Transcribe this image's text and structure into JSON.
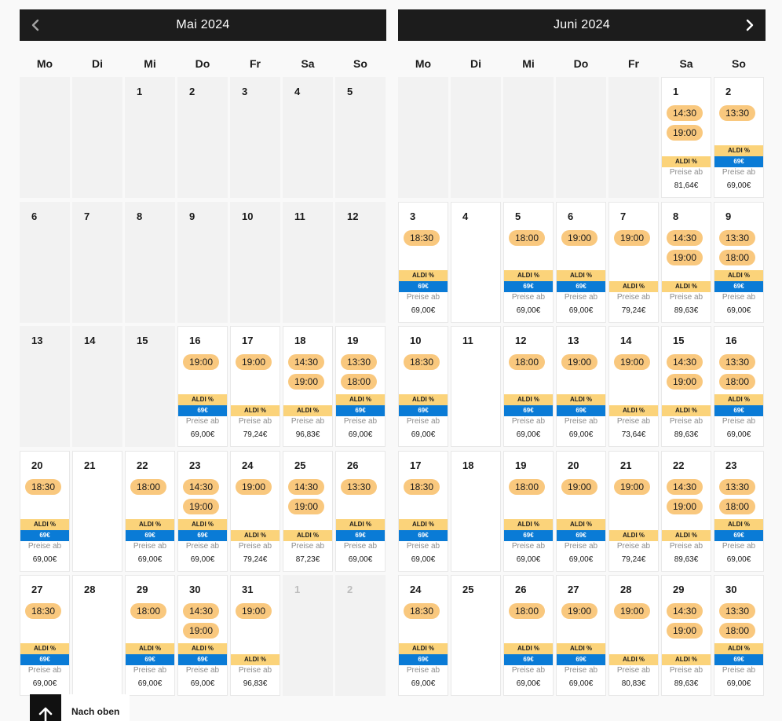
{
  "weekdays": [
    "Mo",
    "Di",
    "Mi",
    "Do",
    "Fr",
    "Sa",
    "So"
  ],
  "labels": {
    "aldi_discount": "ALDI %",
    "price_from": "Preise ab",
    "back_to_top": "Nach oben"
  },
  "icons": {
    "previous_month": "chevron-left-icon",
    "next_month": "chevron-right-icon",
    "back_to_top": "arrow-up-icon"
  },
  "colors": {
    "page_background": "#f9f9f9",
    "header_background": "#1c1c1c",
    "showtime_pill": "#f9c87e",
    "aldi_badge": "#fbd37a",
    "aldi_price_badge": "#0a7bd6",
    "unavailable_day": "#f2f2f2"
  },
  "months": [
    {
      "title": "Mai 2024",
      "days": [
        {},
        {},
        {
          "day": "1",
          "available": false
        },
        {
          "day": "2",
          "available": false
        },
        {
          "day": "3",
          "available": false
        },
        {
          "day": "4",
          "available": false
        },
        {
          "day": "5",
          "available": false
        },
        {
          "day": "6",
          "available": false
        },
        {
          "day": "7",
          "available": false
        },
        {
          "day": "8",
          "available": false
        },
        {
          "day": "9",
          "available": false
        },
        {
          "day": "10",
          "available": false
        },
        {
          "day": "11",
          "available": false
        },
        {
          "day": "12",
          "available": false
        },
        {
          "day": "13",
          "available": false
        },
        {
          "day": "14",
          "available": false
        },
        {
          "day": "15",
          "available": false
        },
        {
          "day": "16",
          "available": true,
          "times": [
            "19:00"
          ],
          "deal": "69€",
          "price": "69,00€"
        },
        {
          "day": "17",
          "available": true,
          "times": [
            "19:00"
          ],
          "price": "79,24€"
        },
        {
          "day": "18",
          "available": true,
          "times": [
            "14:30",
            "19:00"
          ],
          "price": "96,83€"
        },
        {
          "day": "19",
          "available": true,
          "times": [
            "13:30",
            "18:00"
          ],
          "deal": "69€",
          "price": "69,00€"
        },
        {
          "day": "20",
          "available": true,
          "times": [
            "18:30"
          ],
          "deal": "69€",
          "price": "69,00€"
        },
        {
          "day": "21",
          "available": true
        },
        {
          "day": "22",
          "available": true,
          "times": [
            "18:00"
          ],
          "deal": "69€",
          "price": "69,00€"
        },
        {
          "day": "23",
          "available": true,
          "times": [
            "14:30",
            "19:00"
          ],
          "deal": "69€",
          "price": "69,00€"
        },
        {
          "day": "24",
          "available": true,
          "times": [
            "19:00"
          ],
          "price": "79,24€"
        },
        {
          "day": "25",
          "available": true,
          "times": [
            "14:30",
            "19:00"
          ],
          "price": "87,23€"
        },
        {
          "day": "26",
          "available": true,
          "times": [
            "13:30"
          ],
          "deal": "69€",
          "price": "69,00€"
        },
        {
          "day": "27",
          "available": true,
          "times": [
            "18:30"
          ],
          "deal": "69€",
          "price": "69,00€"
        },
        {
          "day": "28",
          "available": true
        },
        {
          "day": "29",
          "available": true,
          "times": [
            "18:00"
          ],
          "deal": "69€",
          "price": "69,00€"
        },
        {
          "day": "30",
          "available": true,
          "times": [
            "14:30",
            "19:00"
          ],
          "deal": "69€",
          "price": "69,00€"
        },
        {
          "day": "31",
          "available": true,
          "times": [
            "19:00"
          ],
          "price": "96,83€"
        },
        {
          "day": "1",
          "available": false,
          "other_month": true
        },
        {
          "day": "2",
          "available": false,
          "other_month": true
        }
      ]
    },
    {
      "title": "Juni 2024",
      "days": [
        {},
        {},
        {},
        {},
        {},
        {
          "day": "1",
          "available": true,
          "times": [
            "14:30",
            "19:00"
          ],
          "price": "81,64€"
        },
        {
          "day": "2",
          "available": true,
          "times": [
            "13:30"
          ],
          "deal": "69€",
          "price": "69,00€"
        },
        {
          "day": "3",
          "available": true,
          "times": [
            "18:30"
          ],
          "deal": "69€",
          "price": "69,00€"
        },
        {
          "day": "4",
          "available": true
        },
        {
          "day": "5",
          "available": true,
          "times": [
            "18:00"
          ],
          "deal": "69€",
          "price": "69,00€"
        },
        {
          "day": "6",
          "available": true,
          "times": [
            "19:00"
          ],
          "deal": "69€",
          "price": "69,00€"
        },
        {
          "day": "7",
          "available": true,
          "times": [
            "19:00"
          ],
          "price": "79,24€"
        },
        {
          "day": "8",
          "available": true,
          "times": [
            "14:30",
            "19:00"
          ],
          "price": "89,63€"
        },
        {
          "day": "9",
          "available": true,
          "times": [
            "13:30",
            "18:00"
          ],
          "deal": "69€",
          "price": "69,00€"
        },
        {
          "day": "10",
          "available": true,
          "times": [
            "18:30"
          ],
          "deal": "69€",
          "price": "69,00€"
        },
        {
          "day": "11",
          "available": true
        },
        {
          "day": "12",
          "available": true,
          "times": [
            "18:00"
          ],
          "deal": "69€",
          "price": "69,00€"
        },
        {
          "day": "13",
          "available": true,
          "times": [
            "19:00"
          ],
          "deal": "69€",
          "price": "69,00€"
        },
        {
          "day": "14",
          "available": true,
          "times": [
            "19:00"
          ],
          "price": "73,64€"
        },
        {
          "day": "15",
          "available": true,
          "times": [
            "14:30",
            "19:00"
          ],
          "price": "89,63€"
        },
        {
          "day": "16",
          "available": true,
          "times": [
            "13:30",
            "18:00"
          ],
          "deal": "69€",
          "price": "69,00€"
        },
        {
          "day": "17",
          "available": true,
          "times": [
            "18:30"
          ],
          "deal": "69€",
          "price": "69,00€"
        },
        {
          "day": "18",
          "available": true
        },
        {
          "day": "19",
          "available": true,
          "times": [
            "18:00"
          ],
          "deal": "69€",
          "price": "69,00€"
        },
        {
          "day": "20",
          "available": true,
          "times": [
            "19:00"
          ],
          "deal": "69€",
          "price": "69,00€"
        },
        {
          "day": "21",
          "available": true,
          "times": [
            "19:00"
          ],
          "price": "79,24€"
        },
        {
          "day": "22",
          "available": true,
          "times": [
            "14:30",
            "19:00"
          ],
          "price": "89,63€"
        },
        {
          "day": "23",
          "available": true,
          "times": [
            "13:30",
            "18:00"
          ],
          "deal": "69€",
          "price": "69,00€"
        },
        {
          "day": "24",
          "available": true,
          "times": [
            "18:30"
          ],
          "deal": "69€",
          "price": "69,00€"
        },
        {
          "day": "25",
          "available": true
        },
        {
          "day": "26",
          "available": true,
          "times": [
            "18:00"
          ],
          "deal": "69€",
          "price": "69,00€"
        },
        {
          "day": "27",
          "available": true,
          "times": [
            "19:00"
          ],
          "deal": "69€",
          "price": "69,00€"
        },
        {
          "day": "28",
          "available": true,
          "times": [
            "19:00"
          ],
          "price": "80,83€"
        },
        {
          "day": "29",
          "available": true,
          "times": [
            "14:30",
            "19:00"
          ],
          "price": "89,63€"
        },
        {
          "day": "30",
          "available": true,
          "times": [
            "13:30",
            "18:00"
          ],
          "deal": "69€",
          "price": "69,00€"
        }
      ]
    }
  ]
}
